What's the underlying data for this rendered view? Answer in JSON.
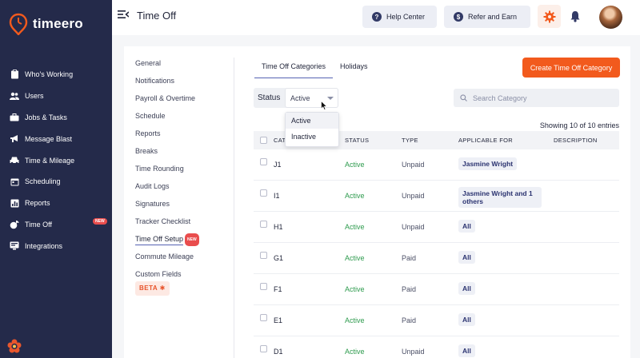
{
  "brand": {
    "name": "timeero",
    "accent": "#f25a1d",
    "sidebar_bg": "#242a4a"
  },
  "sidebar": {
    "items": [
      {
        "label": "Who's Working",
        "icon": "clipboard-icon"
      },
      {
        "label": "Users",
        "icon": "users-icon"
      },
      {
        "label": "Jobs & Tasks",
        "icon": "briefcase-icon"
      },
      {
        "label": "Message Blast",
        "icon": "megaphone-icon"
      },
      {
        "label": "Time & Mileage",
        "icon": "car-icon"
      },
      {
        "label": "Scheduling",
        "icon": "calendar-icon"
      },
      {
        "label": "Reports",
        "icon": "chart-icon"
      },
      {
        "label": "Time Off",
        "icon": "palm-icon",
        "badge": "NEW"
      },
      {
        "label": "Integrations",
        "icon": "integrations-icon"
      }
    ]
  },
  "header": {
    "title": "Time Off",
    "help_label": "Help Center",
    "refer_label": "Refer and Earn"
  },
  "settings_nav": {
    "items": [
      {
        "label": "General"
      },
      {
        "label": "Notifications"
      },
      {
        "label": "Payroll & Overtime"
      },
      {
        "label": "Schedule"
      },
      {
        "label": "Reports"
      },
      {
        "label": "Breaks"
      },
      {
        "label": "Time Rounding"
      },
      {
        "label": "Audit Logs"
      },
      {
        "label": "Signatures"
      },
      {
        "label": "Tracker Checklist"
      },
      {
        "label": "Time Off Setup",
        "badge": "NEW",
        "active": true
      },
      {
        "label": "Commute Mileage"
      },
      {
        "label": "Custom Fields",
        "beta": "BETA"
      }
    ]
  },
  "tabs": [
    {
      "label": "Time Off Categories",
      "active": true
    },
    {
      "label": "Holidays"
    }
  ],
  "create_button": "Create Time Off Category",
  "filter": {
    "label": "Status",
    "value": "Active",
    "options": [
      "Active",
      "Inactive"
    ]
  },
  "search": {
    "placeholder": "Search Category"
  },
  "showing": "Showing 10 of 10 entries",
  "table": {
    "headers": [
      "CAT",
      "STATUS",
      "TYPE",
      "APPLICABLE FOR",
      "DESCRIPTION"
    ],
    "rows": [
      {
        "name": "J1",
        "status": "Active",
        "type": "Unpaid",
        "applicable": "Jasmine Wright"
      },
      {
        "name": "I1",
        "status": "Active",
        "type": "Unpaid",
        "applicable": "Jasmine Wright and 1 others"
      },
      {
        "name": "H1",
        "status": "Active",
        "type": "Unpaid",
        "applicable": "All"
      },
      {
        "name": "G1",
        "status": "Active",
        "type": "Paid",
        "applicable": "All"
      },
      {
        "name": "F1",
        "status": "Active",
        "type": "Paid",
        "applicable": "All"
      },
      {
        "name": "E1",
        "status": "Active",
        "type": "Paid",
        "applicable": "All"
      },
      {
        "name": "D1",
        "status": "Active",
        "type": "Unpaid",
        "applicable": "All"
      }
    ]
  }
}
